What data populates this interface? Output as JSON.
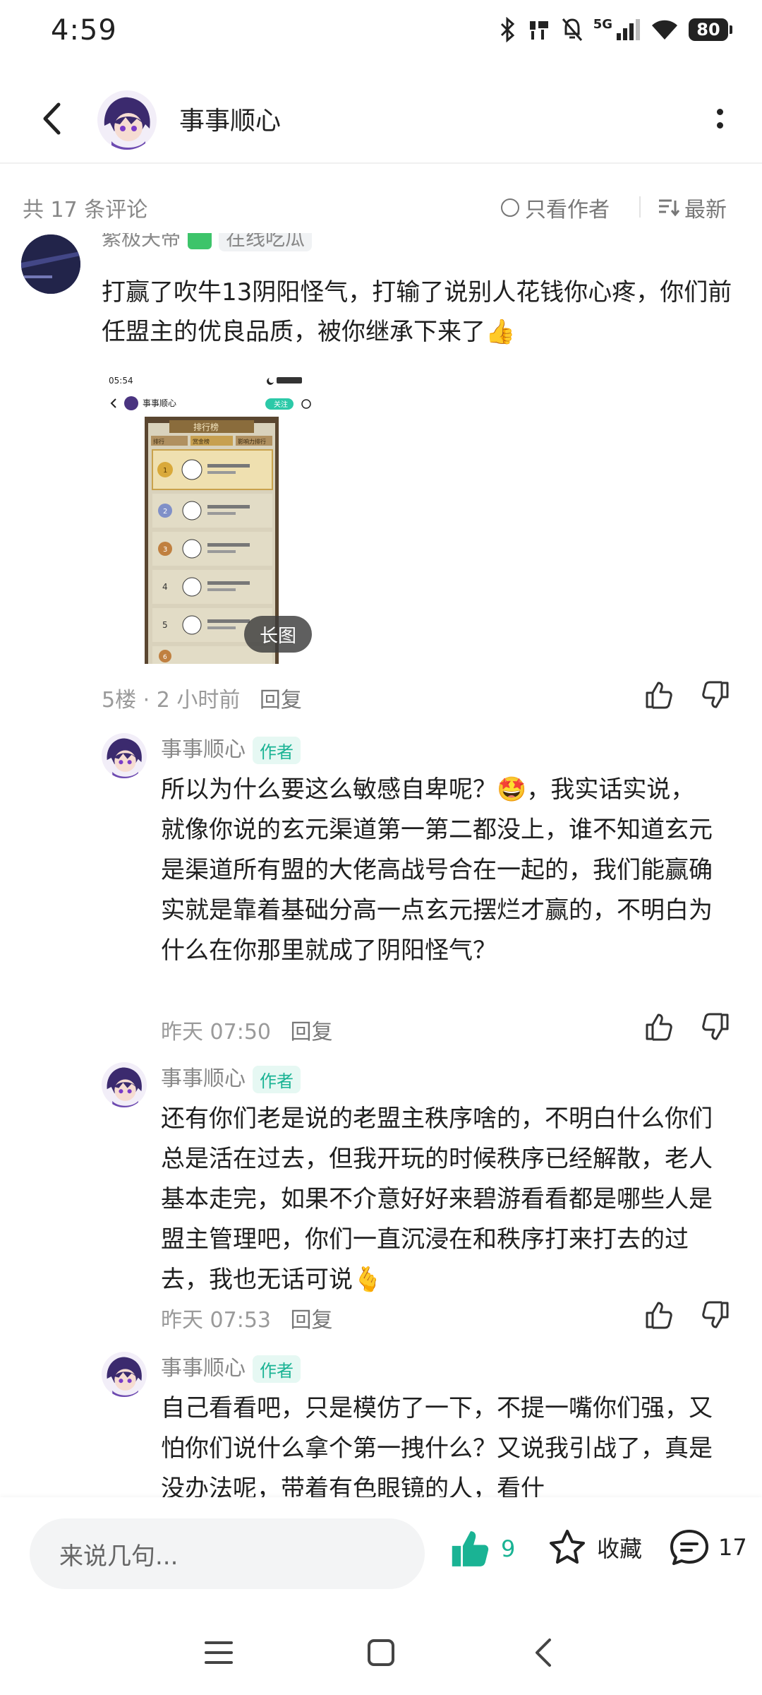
{
  "status_bar": {
    "time": "4:59",
    "network": "5G",
    "battery": "80"
  },
  "header": {
    "title": "事事顺心"
  },
  "filter": {
    "count_label": "共 17 条评论",
    "only_author": "只看作者",
    "sort": "最新"
  },
  "main_comment": {
    "username": "紫极天帝",
    "tag": "在线吃瓜",
    "text": "打赢了吹牛13阴阳怪气，打输了说别人花钱你心疼，你们前任盟主的优良品质，被你继承下来了👍",
    "image": {
      "time": "05:54",
      "page_title": "事事顺心",
      "follow": "关注",
      "panel_title": "排行榜",
      "tabs": [
        "排行",
        "赏金榜",
        "影响力排行"
      ],
      "ranks": [
        "1",
        "2",
        "3",
        "4",
        "5",
        "6"
      ],
      "long_label": "长图"
    },
    "floor": "5楼",
    "time": "2 小时前",
    "reply": "回复"
  },
  "replies": [
    {
      "name": "事事顺心",
      "badge": "作者",
      "text": "所以为什么要这么敏感自卑呢？🤩，我实话实说，就像你说的玄元渠道第一第二都没上，谁不知道玄元是渠道所有盟的大佬高战号合在一起的，我们能赢确实就是靠着基础分高一点玄元摆烂才赢的，不明白为什么在你那里就成了阴阳怪气？",
      "time": "昨天 07:50",
      "reply": "回复"
    },
    {
      "name": "事事顺心",
      "badge": "作者",
      "text": "还有你们老是说的老盟主秩序啥的，不明白什么你们总是活在过去，但我开玩的时候秩序已经解散，老人基本走完，如果不介意好好来碧游看看都是哪些人是盟主管理吧，你们一直沉浸在和秩序打来打去的过去，我也无话可说🫰",
      "time": "昨天 07:53",
      "reply": "回复"
    },
    {
      "name": "事事顺心",
      "badge": "作者",
      "text": "自己看看吧，只是模仿了一下，不提一嘴你们强，又怕你们说什么拿个第一拽什么？又说我引战了，真是没办法呢，带着有色眼镜的人，看什"
    }
  ],
  "bottom": {
    "input_placeholder": "来说几句...",
    "like_count": "9",
    "favorite": "收藏",
    "comment_count": "17"
  },
  "colors": {
    "accent": "#1ab394",
    "badge_bg": "#e6f8f3",
    "muted": "#9a9a9a"
  }
}
